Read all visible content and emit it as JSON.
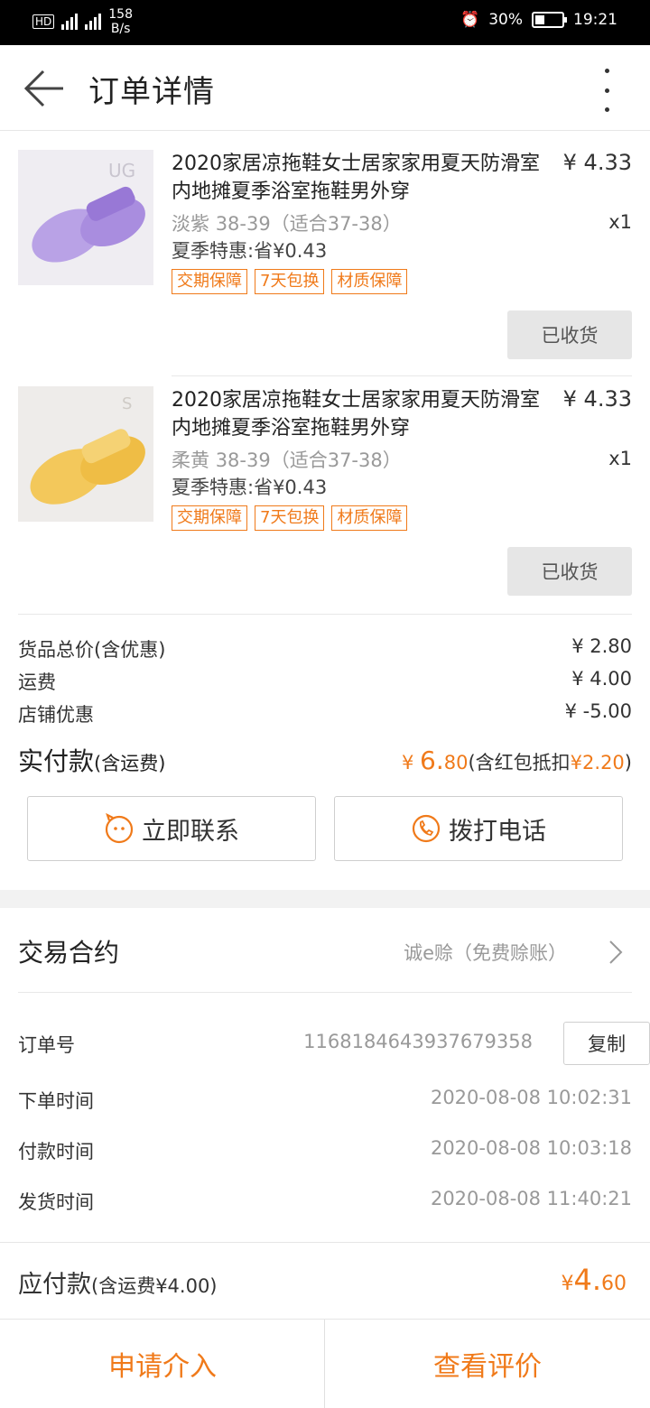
{
  "status_bar": {
    "net_speed_value": "158",
    "net_speed_unit": "B/s",
    "battery": "30%",
    "time": "19:21"
  },
  "header": {
    "title": "订单详情"
  },
  "products": [
    {
      "name": "2020家居凉拖鞋女士居家家用夏天防滑室内地摊夏季浴室拖鞋男外穿",
      "price": "¥ 4.33",
      "qty": "x1",
      "spec_color": "淡紫",
      "spec_size": "38-39（适合37-38）",
      "promo": "夏季特惠:省¥0.43",
      "tags": [
        "交期保障",
        "7天包换",
        "材质保障"
      ],
      "button": "已收货",
      "image_color": "#b9a2e6"
    },
    {
      "name": "2020家居凉拖鞋女士居家家用夏天防滑室内地摊夏季浴室拖鞋男外穿",
      "price": "¥ 4.33",
      "qty": "x1",
      "spec_color": "柔黄",
      "spec_size": "38-39（适合37-38）",
      "promo": "夏季特惠:省¥0.43",
      "tags": [
        "交期保障",
        "7天包换",
        "材质保障"
      ],
      "button": "已收货",
      "image_color": "#f3c85b"
    }
  ],
  "totals": {
    "goods_label": "货品总价(含优惠)",
    "goods_value": "¥ 2.80",
    "shipping_label": "运费",
    "shipping_value": "¥ 4.00",
    "discount_label": "店铺优惠",
    "discount_value": "¥ -5.00",
    "paid_label": "实付款",
    "paid_label_note": "(含运费)",
    "paid_currency": "¥ ",
    "paid_int": "6.",
    "paid_dec": "80",
    "paid_note_prefix": "(含红包抵扣",
    "paid_note_value": "¥2.20",
    "paid_note_suffix": ")"
  },
  "actions": {
    "contact": "立即联系",
    "call": "拨打电话"
  },
  "contract": {
    "label": "交易合约",
    "value": "诚e赊（免费赊账）"
  },
  "order_info": {
    "order_no_label": "订单号",
    "order_no": "1168184643937679358",
    "copy": "复制",
    "created_label": "下单时间",
    "created": "2020-08-08 10:02:31",
    "paid_label": "付款时间",
    "paid": "2020-08-08 10:03:18",
    "shipped_label": "发货时间",
    "shipped": "2020-08-08 11:40:21"
  },
  "payable": {
    "label": "应付款",
    "note": "(含运费¥4.00)",
    "currency": "¥",
    "int": "4.",
    "dec": "60"
  },
  "bottom": {
    "apply": "申请介入",
    "review": "查看评价"
  },
  "colors": {
    "accent": "#f07a1a"
  }
}
